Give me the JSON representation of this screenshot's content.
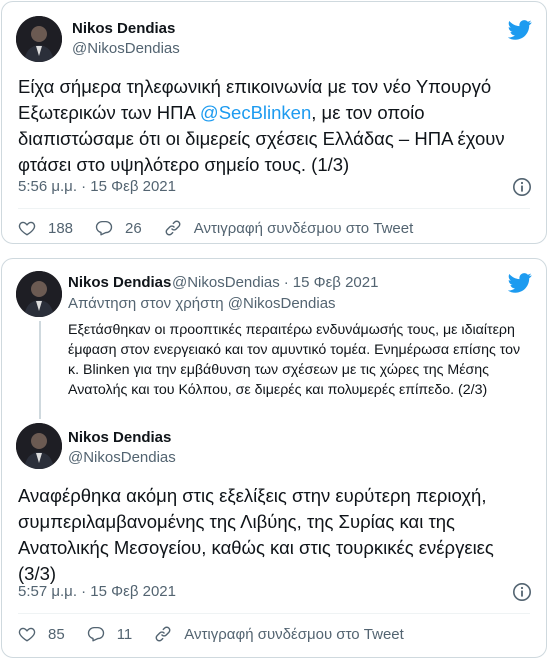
{
  "tweet1": {
    "author_name": "Nikos Dendias",
    "author_handle": "@NikosDendias",
    "text_before": "Είχα σήμερα τηλεφωνική επικοινωνία με τον νέο Υπουργό Εξωτερικών των ΗΠΑ ",
    "mention": "@SecBlinken",
    "text_after": ", με τον οποίο διαπιστώσαμε ότι οι διμερείς σχέσεις Ελλάδας – ΗΠΑ έχουν φτάσει στο υψηλότερο σημείο τους. (1/3)",
    "timestamp": "5:56 μ.μ. · 15 Φεβ 2021",
    "likes": "188",
    "replies": "26",
    "copy_link_label": "Αντιγραφή συνδέσμου στο Tweet"
  },
  "tweet2": {
    "author_name": "Nikos Dendias",
    "author_handle": "@NikosDendias",
    "separator": "·",
    "date": "15 Φεβ 2021",
    "reply_to_label": "Απάντηση στον χρήστη @NikosDendias",
    "text": "Εξετάσθηκαν οι προοπτικές περαιτέρω ενδυνάμωσής τους, με ιδιαίτερη έμφαση στον ενεργειακό και τον αμυντικό τομέα. Ενημέρωσα επίσης τον κ. Blinken για την εμβάθυνση των σχέσεων με τις χώρες της Μέσης Ανατολής και του Κόλπου, σε διμερές και πολυμερές επίπεδο. (2/3)"
  },
  "tweet3": {
    "author_name": "Nikos Dendias",
    "author_handle": "@NikosDendias",
    "text": "Αναφέρθηκα ακόμη στις εξελίξεις στην ευρύτερη περιοχή, συμπεριλαμβανομένης της Λιβύης, της Συρίας και της Ανατολικής Μεσογείου, καθώς και στις τουρκικές ενέργειες (3/3)",
    "timestamp": "5:57 μ.μ. · 15 Φεβ 2021",
    "likes": "85",
    "replies": "11",
    "copy_link_label": "Αντιγραφή συνδέσμου στο Tweet"
  },
  "colors": {
    "brand_blue": "#1d9bf0",
    "text_primary": "#0f1419",
    "text_secondary": "#536471",
    "border": "#cfd9de"
  },
  "icons": [
    "twitter-bird-icon",
    "info-icon",
    "heart-icon",
    "reply-bubble-icon",
    "link-icon"
  ]
}
